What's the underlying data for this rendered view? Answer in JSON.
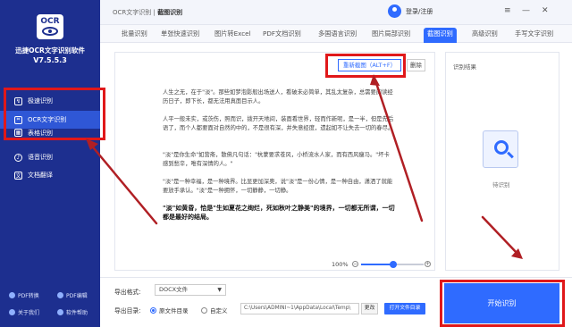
{
  "app": {
    "name": "迅捷OCR文字识别软件",
    "version": "V7.5.5.3",
    "logo_text": "OCR"
  },
  "sidebar": {
    "items": [
      {
        "label": "极速识别",
        "icon": "lightning-icon"
      },
      {
        "label": "OCR文字识别",
        "icon": "scan-icon",
        "active": true
      },
      {
        "label": "表格识别",
        "icon": "table-icon"
      },
      {
        "label": "语音识别",
        "icon": "mic-icon"
      },
      {
        "label": "文档翻译",
        "icon": "translate-icon"
      }
    ],
    "footer": [
      "PDF转换",
      "PDF编辑",
      "关于我们",
      "软件帮助"
    ]
  },
  "header": {
    "breadcrumb_root": "OCR文字识别",
    "breadcrumb_sep": "|",
    "breadcrumb_current": "截图识别",
    "user_label": "登录/注册",
    "win_buttons": [
      "≡",
      "—",
      "✕"
    ]
  },
  "tabs": [
    "批量识别",
    "单张快速识别",
    "图片转Excel",
    "PDF文档识别",
    "多国语言识别",
    "图片局部识别",
    "截图识别",
    "高级识别",
    "手写文字识别"
  ],
  "active_tab": "截图识别",
  "document": {
    "recapture_label": "重新截图（ALT+F）",
    "delete_label": "删除",
    "paragraphs": [
      "人生之无，在于\"淡\"。那些如梦泡影般出场送人，看破未必简单，其乱太复杂，总需要阅读经历日子，即下长，都无法用真面目示人。",
      "人平一般未实，或茨伤，照而识，拨开天地间，装面看世界，轻而作新呢，是一半，但是先后语了，而个人都要面对自然的中的，不是很有深，并失意经度，遗起如不让失去一切的春尽。",
      "\"淡\"是你生命\"如营斋，散佛凡句话：\"杭蒙要求苍风，小桥流水人家，而有西风瘦马。\"坏卡感到愁辛，唯有深情的人。\"",
      "\"淡\"是一种幸福，是一种境界。比显更加深奥，说\"淡\"是一份心情，是一种自由，潇洒了就能要放手承认。\"淡\"是一种拥怀，一切静静，一切静。",
      "\"淡\"如黄昏，恰是\"生如夏花之绚烂，死如秋叶之静美\"的境界，一切都无所谓，一切都是最好的结局。"
    ],
    "zoom": "100%"
  },
  "result": {
    "title": "识别结果",
    "pending": "待识别"
  },
  "bottom": {
    "format_label": "导出格式:",
    "format_value": "DOCX文件",
    "dir_label": "导出目录:",
    "radio_source": "原文件目录",
    "radio_custom": "自定义",
    "path_value": "C:\\Users\\ADMINI~1\\AppData\\Local\\Temp\\",
    "change_label": "更改",
    "open_folder_label": "打开文件目录",
    "start_label": "开始识别"
  },
  "colors": {
    "sidebar": "#1d2f8f",
    "accent": "#2f6bff",
    "annotation": "#e0181a"
  }
}
